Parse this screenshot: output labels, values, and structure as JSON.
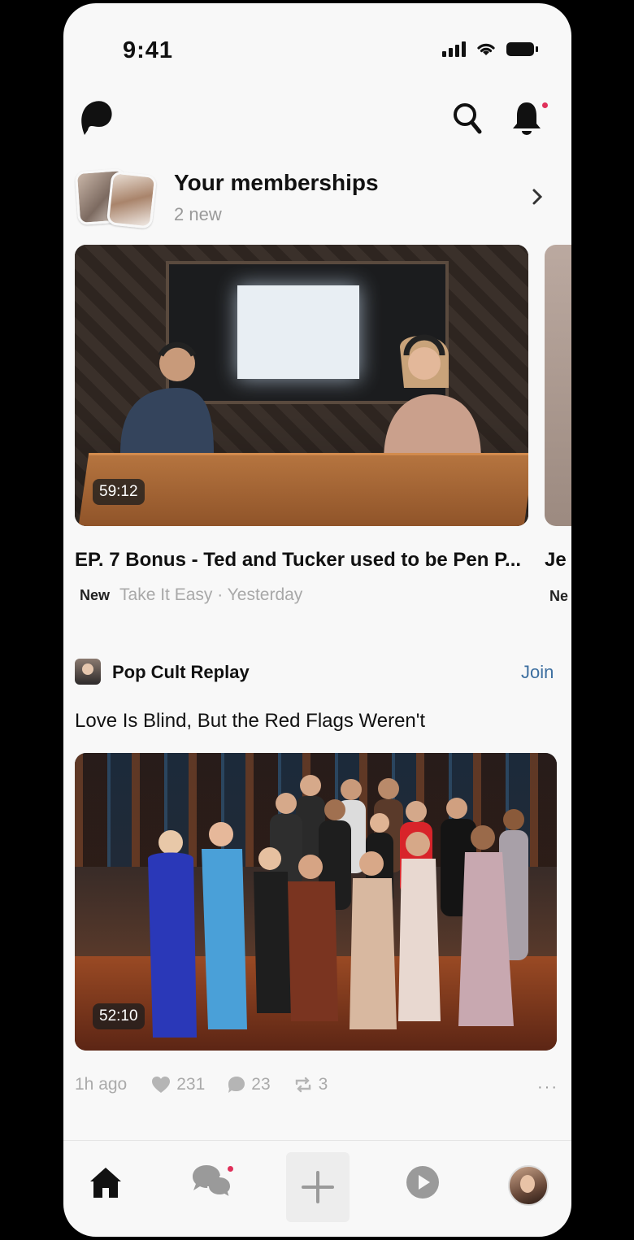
{
  "status_bar": {
    "time": "9:41"
  },
  "header": {
    "logo": "patreon-logo-icon",
    "search_icon": "search-icon",
    "notifications_icon": "bell-icon"
  },
  "memberships": {
    "title": "Your memberships",
    "subtitle": "2 new"
  },
  "featured": {
    "duration": "59:12",
    "title": "EP. 7 Bonus - Ted and Tucker used to be Pen P...",
    "badge": "New",
    "creator_and_time": "Take It Easy · Yesterday",
    "peek_title": "Je",
    "peek_badge": "Ne"
  },
  "post": {
    "author": "Pop Cult Replay",
    "join_label": "Join",
    "title": "Love Is Blind, But the Red Flags Weren't",
    "duration": "52:10",
    "time_ago": "1h ago",
    "likes": "231",
    "comments": "23",
    "reposts": "3",
    "more": "···"
  },
  "tab_bar": {
    "items": [
      "home-icon",
      "chat-icon",
      "plus-icon",
      "play-icon",
      "avatar"
    ]
  },
  "colors": {
    "accent_dot": "#e0305a",
    "join": "#3d6fa0",
    "background": "#f8f8f8"
  }
}
